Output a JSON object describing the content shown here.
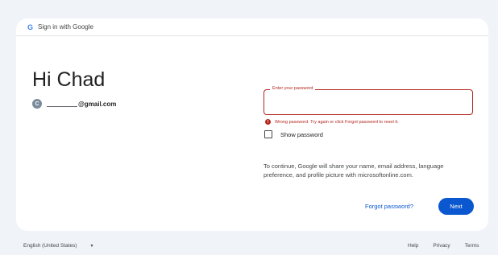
{
  "header": {
    "icon": "google-g-icon",
    "title": "Sign in with Google"
  },
  "greeting": "Hi Chad",
  "account": {
    "avatar_letter": "C",
    "email_suffix": "@gmail.com"
  },
  "password": {
    "label": "Enter your password",
    "value": "",
    "error": "Wrong password. Try again or click Forgot password to reset it.",
    "error_icon": "!"
  },
  "show_password": {
    "label": "Show password",
    "checked": false
  },
  "consent": "To continue, Google will share your name, email address, language preference, and profile picture with microsoftonline.com.",
  "actions": {
    "forgot": "Forgot password?",
    "next": "Next"
  },
  "footer": {
    "language": "English (United States)",
    "links": [
      "Help",
      "Privacy",
      "Terms"
    ]
  },
  "colors": {
    "accent": "#0b57d0",
    "error": "#b3261e",
    "background": "#f0f4f9"
  }
}
